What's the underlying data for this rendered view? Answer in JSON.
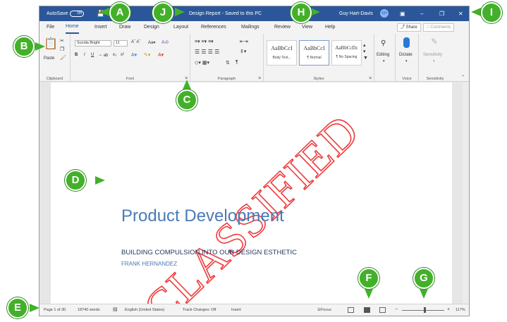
{
  "titlebar": {
    "autosave_label": "AutoSave",
    "autosave_state": "Off",
    "document_title": "Design Report - Saved to this PC",
    "user_name": "Guy Hart-Davis",
    "user_initials": "GH",
    "minimize": "–",
    "restore": "❐",
    "close": "✕"
  },
  "tabs": [
    "File",
    "Home",
    "Insert",
    "Draw",
    "Design",
    "Layout",
    "References",
    "Mailings",
    "Review",
    "View",
    "Help"
  ],
  "share_label": "Share",
  "comments_label": "Comments",
  "ribbon": {
    "clipboard": {
      "paste_label": "Paste",
      "group_label": "Clipboard"
    },
    "font": {
      "font_name": "Sucida Bright",
      "font_size": "11",
      "group_label": "Font"
    },
    "paragraph": {
      "group_label": "Paragraph"
    },
    "styles": {
      "group_label": "Styles",
      "items": [
        {
          "preview": "AaBbCcI",
          "name": "Body Text..."
        },
        {
          "preview": "AaBbCcI",
          "name": "¶ Normal"
        },
        {
          "preview": "AaBbCcDc",
          "name": "¶ No Spacing"
        }
      ]
    },
    "editing": {
      "label": "Editing"
    },
    "voice": {
      "dictate_label": "Dictate",
      "group_label": "Voice"
    },
    "sensitivity": {
      "label": "Sensitivity",
      "group_label": "Sensitivity"
    }
  },
  "document": {
    "title": "Product Development",
    "subtitle": "BUILDING COMPULSION INTO OUR DESIGN ESTHETIC",
    "author": "FRANK HERNANDEZ",
    "watermark": "CLASSIFIED"
  },
  "statusbar": {
    "page": "Page 1 of 30",
    "words": "18740 words",
    "language": "English (United States)",
    "track_changes": "Track Changes: Off",
    "insert": "Insert",
    "focus": "Focus",
    "zoom": "- + 117%",
    "zoom_percent": "117%"
  },
  "callouts": [
    "A",
    "B",
    "C",
    "D",
    "E",
    "F",
    "G",
    "H",
    "I",
    "J"
  ],
  "colors": {
    "accent": "#2b579a",
    "callout": "#43b02a",
    "watermark": "#f03a3a",
    "title": "#4a7ab5"
  }
}
